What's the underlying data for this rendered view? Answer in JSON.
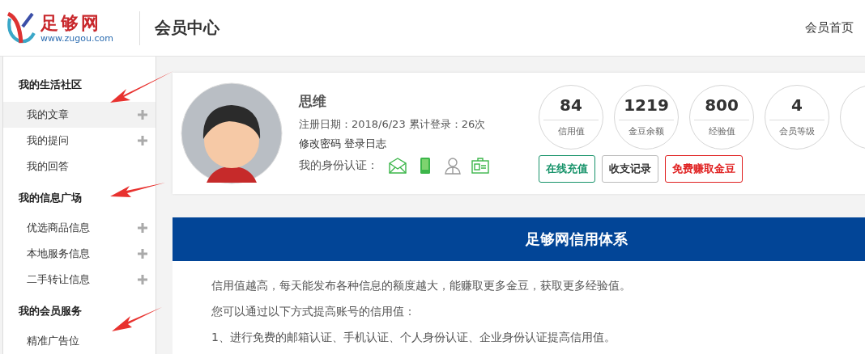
{
  "header": {
    "logo_title": "足够网",
    "logo_url": "www.zugou.com",
    "page_title": "会员中心",
    "home_link": "会员首页"
  },
  "sidebar": {
    "sections": [
      {
        "title": "我的生活社区",
        "items": [
          {
            "label": "我的文章",
            "selected": true,
            "addable": true
          },
          {
            "label": "我的提问",
            "selected": false,
            "addable": true
          },
          {
            "label": "我的回答",
            "selected": false,
            "addable": false
          }
        ]
      },
      {
        "title": "我的信息广场",
        "items": [
          {
            "label": "优选商品信息",
            "selected": false,
            "addable": true
          },
          {
            "label": "本地服务信息",
            "selected": false,
            "addable": true
          },
          {
            "label": "二手转让信息",
            "selected": false,
            "addable": true
          }
        ]
      },
      {
        "title": "我的会员服务",
        "items": [
          {
            "label": "精准广告位",
            "selected": false,
            "addable": false
          }
        ]
      }
    ]
  },
  "profile": {
    "name": "思维",
    "register_info": "注册日期：2018/6/23 累计登录：26次",
    "links": [
      "修改密码",
      "登录日志"
    ],
    "verify_label": "我的身份认证：",
    "verifications": [
      {
        "kind": "email",
        "verified": true
      },
      {
        "kind": "phone",
        "verified": true
      },
      {
        "kind": "person",
        "verified": false
      },
      {
        "kind": "idcard",
        "verified": true
      }
    ],
    "stats": [
      {
        "value": "84",
        "label": "信用值"
      },
      {
        "value": "1219",
        "label": "金豆余额"
      },
      {
        "value": "800",
        "label": "经验值"
      },
      {
        "value": "4",
        "label": "会员等级"
      }
    ],
    "buttons": [
      {
        "label": "在线充值",
        "kind": "green"
      },
      {
        "label": "收支记录",
        "kind": "plain"
      },
      {
        "label": "免费赚取金豆",
        "kind": "red"
      }
    ]
  },
  "credit": {
    "title": "足够网信用体系",
    "paragraphs": [
      "信用值越高，每天能发布各种信息的额度越大，能赚取更多金豆，获取更多经验值。",
      "您可以通过以下方式提高账号的信用值：",
      "1、进行免费的邮箱认证、手机认证、个人身份认证、企业身份认证提高信用值。"
    ]
  }
}
